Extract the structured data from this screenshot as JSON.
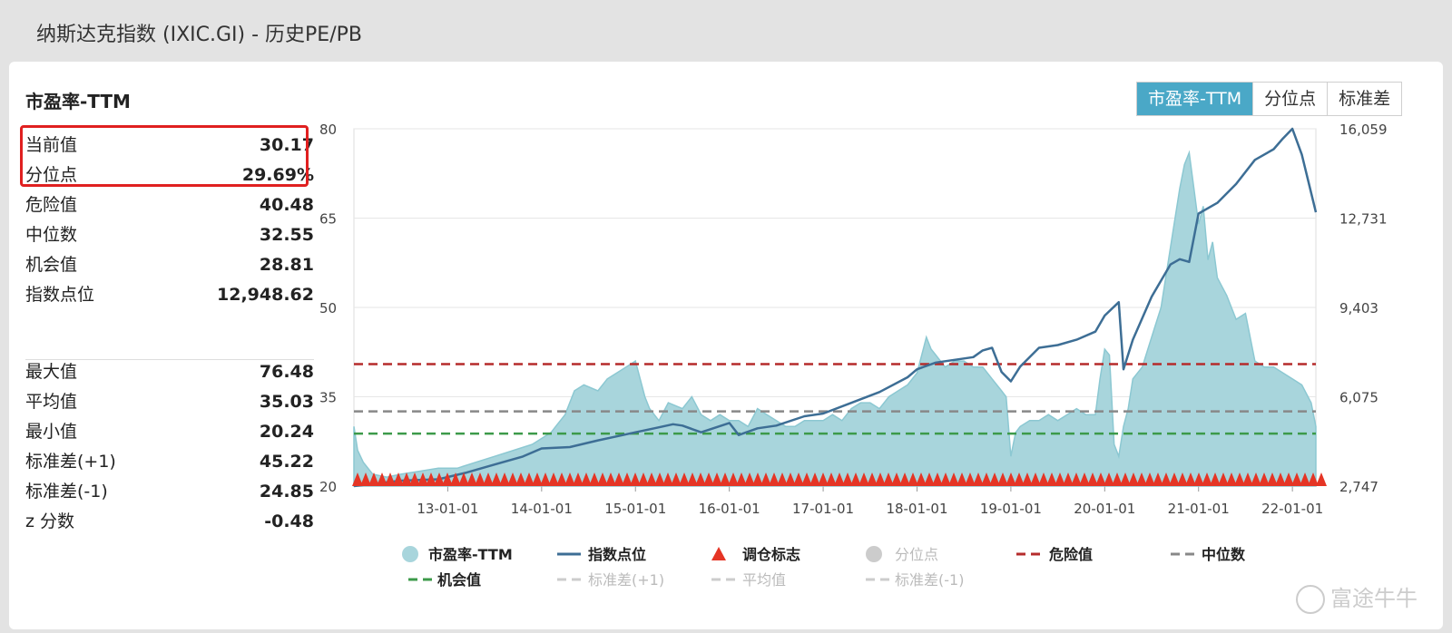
{
  "window_title": "纳斯达克指数 (IXIC.GI) - 历史PE/PB",
  "panel_title": "市盈率-TTM",
  "tabs": [
    "市盈率-TTM",
    "分位点",
    "标准差"
  ],
  "stats_top": [
    {
      "label": "当前值",
      "value": "30.17"
    },
    {
      "label": "分位点",
      "value": "29.69%"
    },
    {
      "label": "危险值",
      "value": "40.48"
    },
    {
      "label": "中位数",
      "value": "32.55"
    },
    {
      "label": "机会值",
      "value": "28.81"
    },
    {
      "label": "指数点位",
      "value": "12,948.62"
    }
  ],
  "stats_bottom": [
    {
      "label": "最大值",
      "value": "76.48"
    },
    {
      "label": "平均值",
      "value": "35.03"
    },
    {
      "label": "最小值",
      "value": "20.24"
    },
    {
      "label": "标准差(+1)",
      "value": "45.22"
    },
    {
      "label": "标准差(-1)",
      "value": "24.85"
    },
    {
      "label": "z 分数",
      "value": "-0.48"
    }
  ],
  "watermark": "富途牛牛",
  "colors": {
    "pe_fill": "#a8d5dc",
    "pe_stroke": "#8cc8d2",
    "index_line": "#3d6e95",
    "danger": "#b52b2b",
    "median": "#888888",
    "opportunity": "#3c9a4a",
    "marker": "#e53525",
    "tab_active": "#4aa8c7"
  },
  "chart_data": {
    "type": "area",
    "x_tick_labels": [
      "13-01-01",
      "14-01-01",
      "15-01-01",
      "16-01-01",
      "17-01-01",
      "18-01-01",
      "19-01-01",
      "20-01-01",
      "21-01-01",
      "22-01-01"
    ],
    "x_range": [
      2012.0,
      2022.25
    ],
    "y_left_ticks": [
      "80",
      "65",
      "50",
      "35",
      "20"
    ],
    "y_left_range": [
      20,
      80
    ],
    "y_right_ticks": [
      "16,059",
      "12,731",
      "9,403",
      "6,075",
      "2,747"
    ],
    "y_right_range": [
      2747,
      16059
    ],
    "reference_lines": [
      {
        "name": "危险值",
        "value": 40.48
      },
      {
        "name": "中位数",
        "value": 32.55
      },
      {
        "name": "机会值",
        "value": 28.81
      }
    ],
    "series": [
      {
        "name": "市盈率-TTM",
        "x": [
          2012.0,
          2012.04,
          2012.1,
          2012.2,
          2012.35,
          2012.5,
          2012.7,
          2012.9,
          2013.1,
          2013.3,
          2013.5,
          2013.7,
          2013.9,
          2014.0,
          2014.1,
          2014.15,
          2014.25,
          2014.35,
          2014.45,
          2014.6,
          2014.7,
          2014.8,
          2014.9,
          2015.0,
          2015.1,
          2015.15,
          2015.25,
          2015.35,
          2015.5,
          2015.6,
          2015.7,
          2015.8,
          2015.9,
          2016.0,
          2016.1,
          2016.2,
          2016.3,
          2016.4,
          2016.5,
          2016.6,
          2016.7,
          2016.8,
          2016.9,
          2017.0,
          2017.1,
          2017.2,
          2017.3,
          2017.4,
          2017.5,
          2017.6,
          2017.7,
          2017.8,
          2017.9,
          2018.0,
          2018.05,
          2018.1,
          2018.15,
          2018.2,
          2018.25,
          2018.3,
          2018.4,
          2018.5,
          2018.6,
          2018.7,
          2018.8,
          2018.9,
          2018.95,
          2019.0,
          2019.05,
          2019.1,
          2019.2,
          2019.3,
          2019.4,
          2019.5,
          2019.6,
          2019.7,
          2019.8,
          2019.9,
          2019.95,
          2020.0,
          2020.05,
          2020.1,
          2020.15,
          2020.2,
          2020.25,
          2020.3,
          2020.4,
          2020.5,
          2020.6,
          2020.7,
          2020.8,
          2020.85,
          2020.9,
          2020.95,
          2021.0,
          2021.05,
          2021.1,
          2021.15,
          2021.2,
          2021.3,
          2021.4,
          2021.5,
          2021.6,
          2021.7,
          2021.8,
          2021.9,
          2022.0,
          2022.1,
          2022.2,
          2022.25
        ],
        "values": [
          30,
          26,
          24,
          22,
          21.5,
          22,
          22.5,
          23,
          23,
          24,
          25,
          26,
          27,
          28,
          29,
          30,
          32,
          36,
          37,
          36,
          38,
          39,
          40,
          41,
          35,
          33,
          31,
          34,
          33,
          35,
          32,
          31,
          32,
          31,
          31,
          30,
          33,
          32,
          31,
          30,
          30,
          31,
          31,
          31,
          32,
          31,
          33,
          34,
          34,
          33,
          35,
          36,
          37,
          39,
          42,
          45,
          43,
          42,
          41,
          40,
          41,
          41,
          40,
          40,
          38,
          36,
          35,
          25,
          29,
          30,
          31,
          31,
          32,
          31,
          32,
          33,
          32,
          32,
          38,
          43,
          42,
          27,
          25,
          30,
          33,
          38,
          40,
          45,
          50,
          60,
          70,
          74,
          76,
          70,
          64,
          67,
          58,
          61,
          55,
          52,
          48,
          49,
          41,
          40,
          40,
          39,
          38,
          37,
          34,
          30
        ]
      },
      {
        "name": "指数点位",
        "x": [
          2012.0,
          2012.5,
          2012.9,
          2013.2,
          2013.5,
          2013.8,
          2014.0,
          2014.3,
          2014.6,
          2014.8,
          2015.0,
          2015.2,
          2015.4,
          2015.5,
          2015.7,
          2016.0,
          2016.1,
          2016.3,
          2016.5,
          2016.8,
          2017.0,
          2017.3,
          2017.6,
          2017.9,
          2018.0,
          2018.2,
          2018.4,
          2018.6,
          2018.7,
          2018.8,
          2018.9,
          2019.0,
          2019.1,
          2019.3,
          2019.5,
          2019.7,
          2019.9,
          2020.0,
          2020.15,
          2020.2,
          2020.3,
          2020.5,
          2020.7,
          2020.8,
          2020.9,
          2021.0,
          2021.2,
          2021.4,
          2021.6,
          2021.8,
          2021.9,
          2022.0,
          2022.1,
          2022.25
        ],
        "values": [
          2747,
          2950,
          3000,
          3250,
          3550,
          3850,
          4150,
          4200,
          4450,
          4600,
          4750,
          4900,
          5050,
          5000,
          4750,
          5100,
          4650,
          4900,
          5000,
          5350,
          5450,
          5850,
          6250,
          6800,
          7100,
          7350,
          7450,
          7550,
          7800,
          7900,
          7000,
          6650,
          7200,
          7900,
          8000,
          8200,
          8500,
          9100,
          9600,
          7100,
          8200,
          9800,
          11000,
          11200,
          11100,
          12900,
          13300,
          14000,
          14900,
          15300,
          15700,
          16059,
          15100,
          12948
        ]
      }
    ]
  },
  "legend": [
    "市盈率-TTM",
    "指数点位",
    "调仓标志",
    "分位点",
    "危险值",
    "中位数",
    "机会值",
    "标准差(+1)",
    "平均值",
    "标准差(-1)"
  ]
}
